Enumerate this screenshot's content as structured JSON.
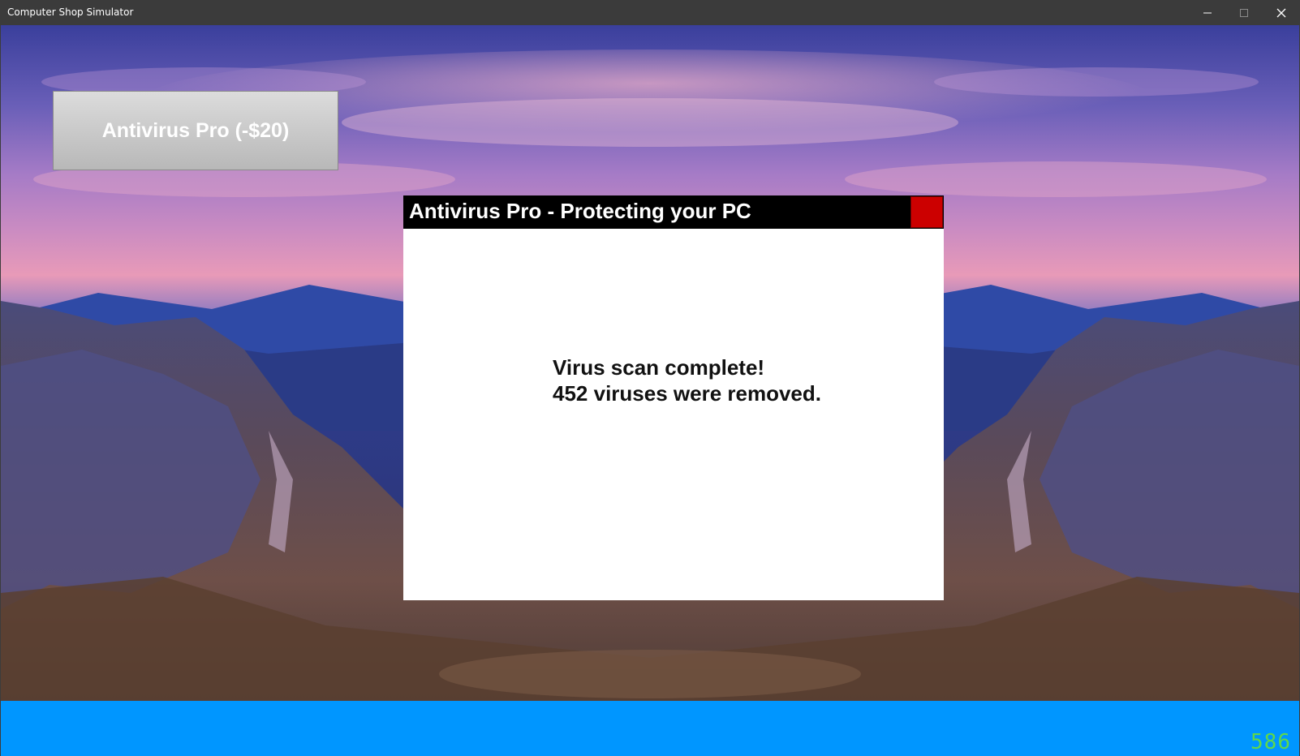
{
  "window": {
    "title": "Computer Shop Simulator",
    "controls": {
      "minimize_icon": "minimize-icon",
      "maximize_icon": "maximize-icon",
      "close_icon": "close-icon"
    }
  },
  "game": {
    "buy_button_label": "Antivirus Pro (-$20)",
    "button_color": "#c8c8c8"
  },
  "popup": {
    "title": "Antivirus Pro - Protecting your PC",
    "close_color": "#cc0000",
    "message_line1": "Virus scan complete!",
    "message_line2": "452 viruses were removed."
  },
  "status_bar": {
    "color": "#0096ff",
    "counter": "586",
    "counter_color": "#5fd84a"
  }
}
